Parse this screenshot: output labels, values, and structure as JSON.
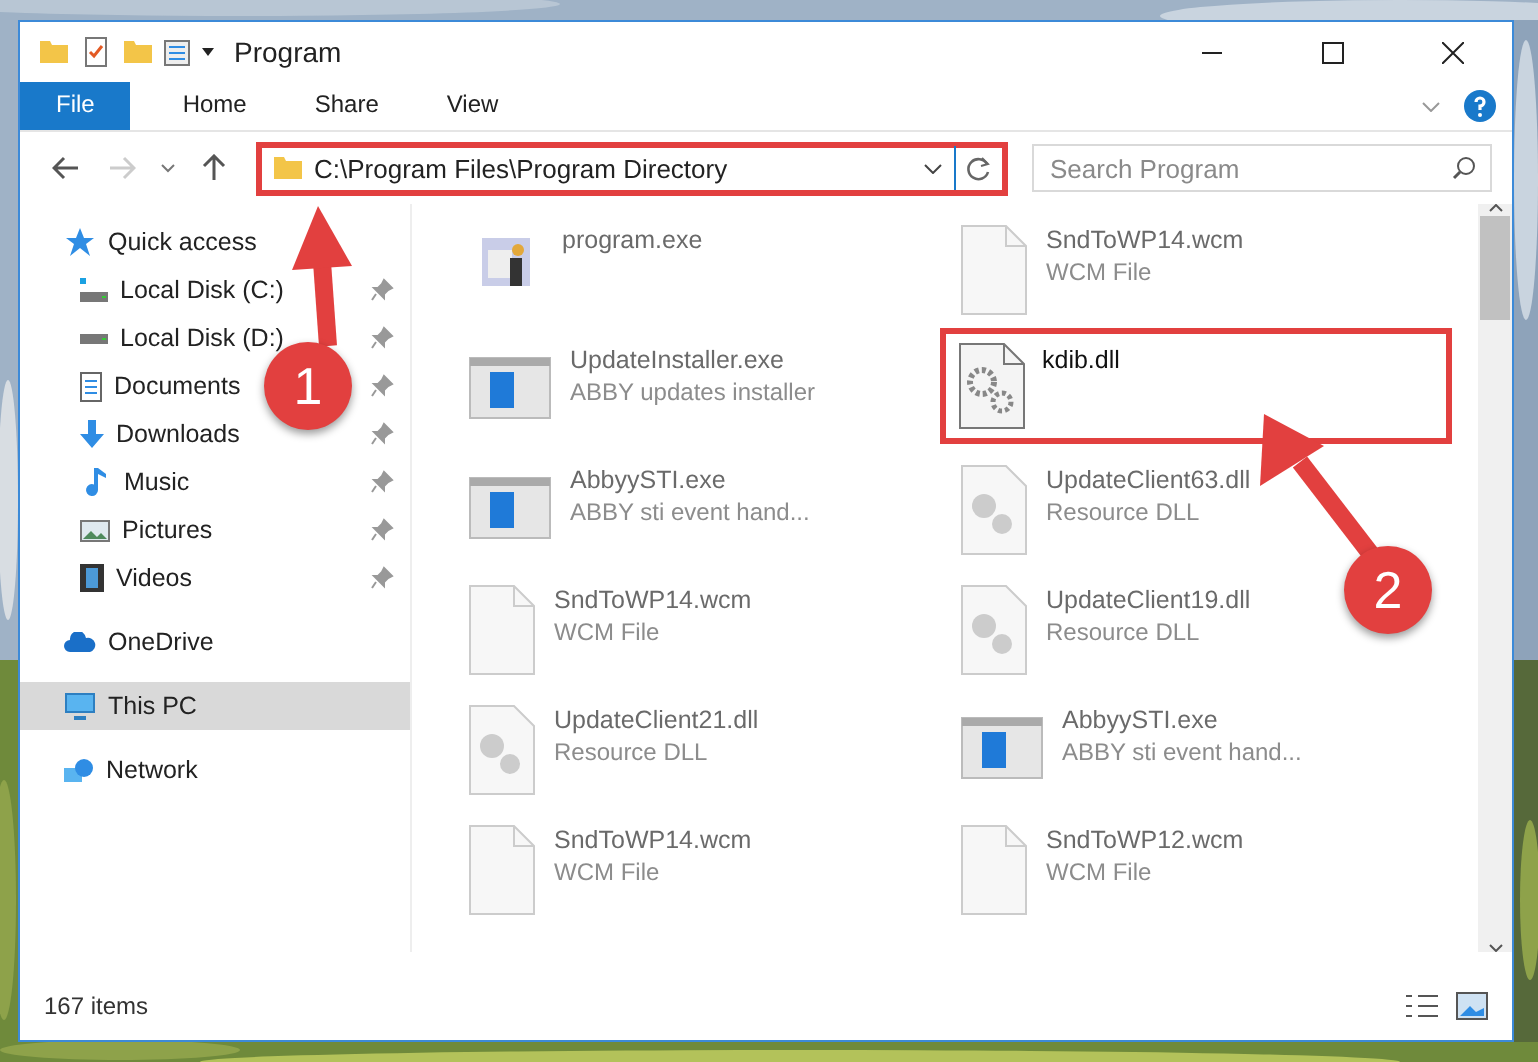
{
  "window": {
    "title": "Program"
  },
  "ribbon_tabs": [
    {
      "label": "File",
      "selected": true
    },
    {
      "label": "Home",
      "selected": false
    },
    {
      "label": "Share",
      "selected": false
    },
    {
      "label": "View",
      "selected": false
    }
  ],
  "address": {
    "path": "C:\\Program Files\\Program Directory",
    "highlighted": true
  },
  "search": {
    "placeholder": "Search Program"
  },
  "sidebar": {
    "items": [
      {
        "label": "Quick access",
        "kind": "star",
        "selected": false,
        "children": [
          {
            "label": "Local Disk (C:)",
            "kind": "disk-c",
            "pinned": true,
            "selected": false
          },
          {
            "label": "Local Disk (D:)",
            "kind": "disk",
            "pinned": true,
            "selected": false
          },
          {
            "label": "Documents",
            "kind": "documents",
            "pinned": true,
            "selected": false
          },
          {
            "label": "Downloads",
            "kind": "downloads",
            "pinned": true,
            "selected": false
          },
          {
            "label": "Music",
            "kind": "music",
            "pinned": true,
            "selected": false
          },
          {
            "label": "Pictures",
            "kind": "pictures",
            "pinned": true,
            "selected": false
          },
          {
            "label": "Videos",
            "kind": "videos",
            "pinned": true,
            "selected": false
          }
        ]
      },
      {
        "label": "OneDrive",
        "kind": "cloud",
        "selected": false
      },
      {
        "label": "This PC",
        "kind": "pc",
        "selected": true
      },
      {
        "label": "Network",
        "kind": "network",
        "selected": false
      }
    ]
  },
  "files": [
    {
      "name": "program.exe",
      "kind": "setup",
      "blurred": true,
      "highlighted": false
    },
    {
      "name": "SndToWP14.wcm",
      "type": "WCM File",
      "kind": "blank",
      "blurred": true,
      "highlighted": false
    },
    {
      "name": "UpdateInstaller.exe",
      "type": "ABBY updates installer",
      "kind": "app",
      "blurred": true,
      "highlighted": false
    },
    {
      "name": "kdib.dll",
      "kind": "gears",
      "blurred": false,
      "highlighted": true
    },
    {
      "name": "AbbyySTI.exe",
      "type": "ABBY sti event hand...",
      "kind": "app",
      "blurred": true,
      "highlighted": false
    },
    {
      "name": "UpdateClient63.dll",
      "type": "Resource DLL",
      "kind": "dll",
      "blurred": true,
      "highlighted": false
    },
    {
      "name": "SndToWP14.wcm",
      "type": "WCM File",
      "kind": "blank",
      "blurred": true,
      "highlighted": false
    },
    {
      "name": "UpdateClient19.dll",
      "type": "Resource DLL",
      "kind": "dll",
      "blurred": true,
      "highlighted": false
    },
    {
      "name": "UpdateClient21.dll",
      "type": "Resource DLL",
      "kind": "dll",
      "blurred": true,
      "highlighted": false
    },
    {
      "name": "AbbyySTI.exe",
      "type": "ABBY sti event hand...",
      "kind": "app",
      "blurred": true,
      "highlighted": false
    },
    {
      "name": "SndToWP14.wcm",
      "type": "WCM File",
      "kind": "blank",
      "blurred": true,
      "highlighted": false
    },
    {
      "name": "SndToWP12.wcm",
      "type": "WCM File",
      "kind": "blank",
      "blurred": true,
      "highlighted": false
    }
  ],
  "annotations": [
    {
      "label": "1"
    },
    {
      "label": "2"
    }
  ],
  "status_bar": {
    "count": "167 items"
  }
}
